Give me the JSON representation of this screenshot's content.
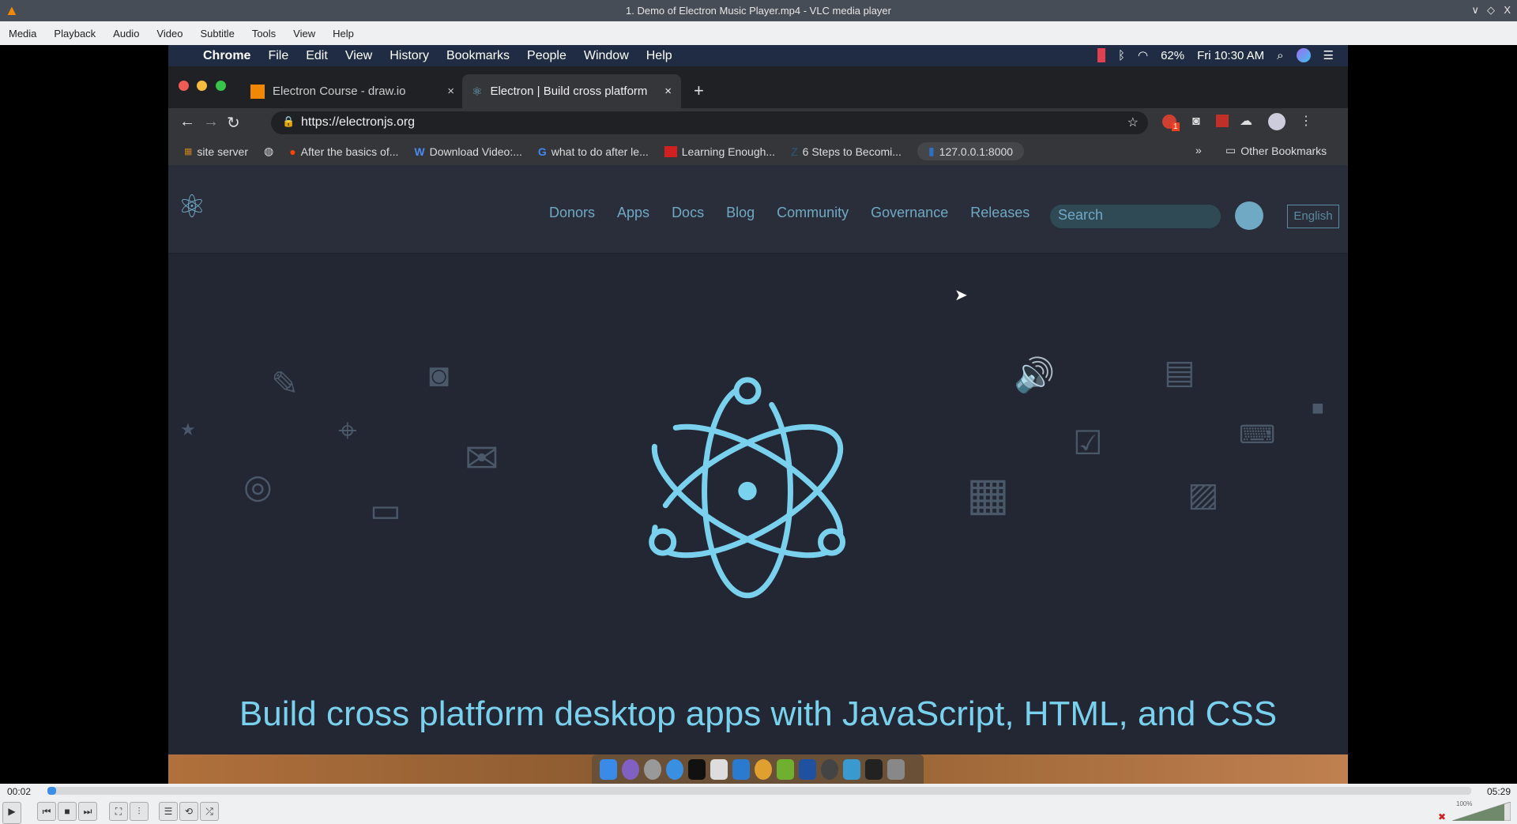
{
  "window": {
    "title": "1. Demo of Electron Music Player.mp4 - VLC media player",
    "controls": [
      "∨",
      "◇",
      "X"
    ]
  },
  "vlc_menu": [
    "Media",
    "Playback",
    "Audio",
    "Video",
    "Subtitle",
    "Tools",
    "View",
    "Help"
  ],
  "mac_menu": {
    "items": [
      "Chrome",
      "File",
      "Edit",
      "View",
      "History",
      "Bookmarks",
      "People",
      "Window",
      "Help"
    ],
    "battery": "62%",
    "clock": "Fri 10:30 AM"
  },
  "tabs": [
    {
      "label": "Electron Course - draw.io"
    },
    {
      "label": "Electron | Build cross platform"
    }
  ],
  "address": {
    "url": "https://electronjs.org"
  },
  "bookmarks": [
    "site server",
    "After the basics of...",
    "Download Video:...",
    "what to do after le...",
    "Learning Enough...",
    "6 Steps to Becomi...",
    "127.0.0.1:8000"
  ],
  "other_bookmarks": "Other Bookmarks",
  "extension_badge": "1",
  "site": {
    "nav": [
      "Donors",
      "Apps",
      "Docs",
      "Blog",
      "Community",
      "Governance",
      "Releases"
    ],
    "search_placeholder": "Search",
    "language": "English",
    "tagline": "Build cross platform desktop apps with JavaScript, HTML, and CSS"
  },
  "player": {
    "elapsed": "00:02",
    "duration": "05:29",
    "progress": 0.006,
    "volume": "100%"
  },
  "colors": {
    "accent": "#7ad1ee",
    "vlc_progress": "#3c8ee8"
  }
}
